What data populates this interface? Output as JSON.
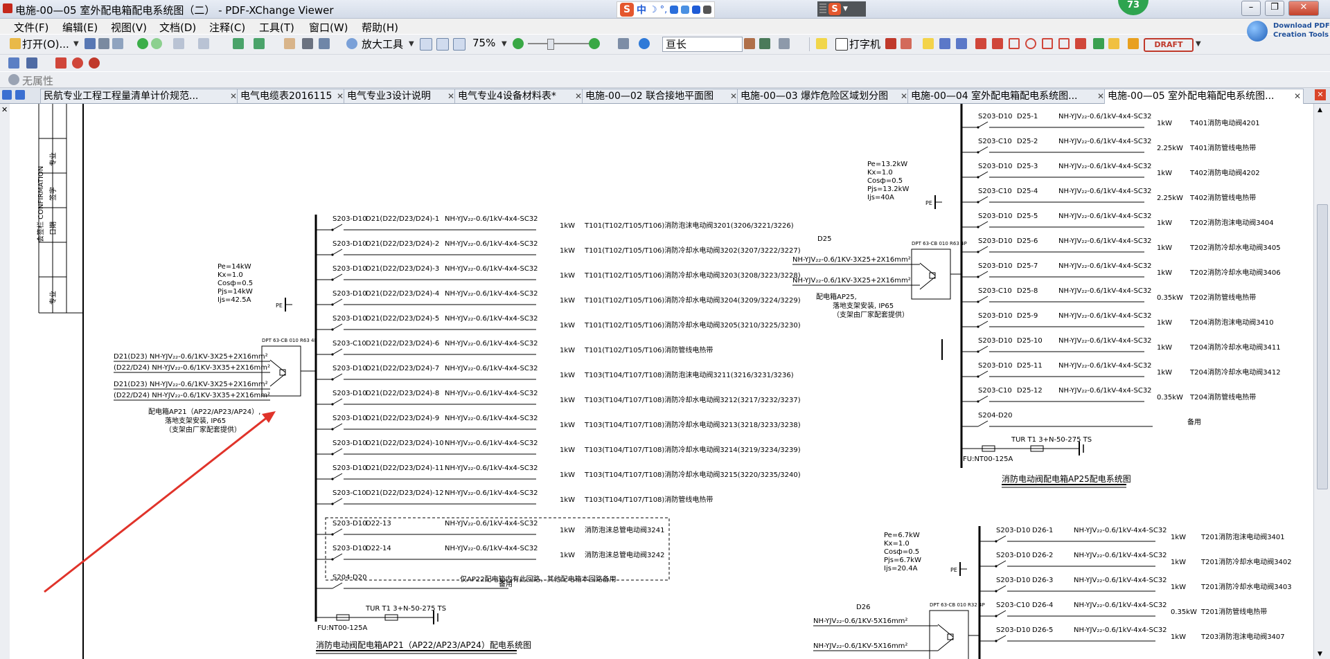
{
  "window": {
    "title": "电施-00—05 室外配电箱配电系统图（二） - PDF-XChange Viewer",
    "badge": "73",
    "ime_cn": "中"
  },
  "menu": [
    "文件(F)",
    "编辑(E)",
    "视图(V)",
    "文档(D)",
    "注释(C)",
    "工具(T)",
    "窗口(W)",
    "帮助(H)"
  ],
  "toolbar": {
    "open_label": "打开(O)...",
    "zoom_tool_label": "放大工具",
    "zoom_value": "75%",
    "search_value": "亘长",
    "typewriter_label": "打字机",
    "draft_stamp": "DRAFT",
    "promo_line1": "Download PDF",
    "promo_line2": "Creation Tools",
    "properties_label": "无属性"
  },
  "tabs": [
    "民航专业工程工程量清单计价规范...",
    "电气电缆表2016115",
    "电气专业3设计说明",
    "电气专业4设备材料表*",
    "电施-00—02 联合接地平面图",
    "电施-00—03 爆炸危险区域划分图",
    "电施-00—04 室外配电箱配电系统图...",
    "电施-00—05 室外配电箱配电系统图..."
  ],
  "drawing": {
    "titleblock": [
      "会签栏 CONFIRMATION",
      "专业",
      "签字",
      "日期"
    ],
    "ap21": {
      "params": [
        "Pe=14kW",
        "Kx=1.0",
        "Cosф=0.5",
        "Pjs=14kW",
        "Ijs=42.5A"
      ],
      "pe_label": "PE",
      "switch_label": "DPT 63-CB 010 R63 4P",
      "feeds": [
        "D21(D23) NH-YJV₂₂-0.6/1KV-3X25+2X16mm²",
        "(D22/D24) NH-YJV₂₂-0.6/1KV-3X35+2X16mm²",
        "D21(D23) NH-YJV₂₂-0.6/1KV-3X25+2X16mm²",
        "(D22/D24) NH-YJV₂₂-0.6/1KV-3X35+2X16mm²"
      ],
      "desc": [
        "配电箱AP21（AP22/AP23/AP24）,",
        "落地支架安装, IP65",
        "（支架由厂家配套提供）"
      ],
      "circuits": [
        {
          "breaker": "S203-D10",
          "id": "D21(D22/D23/D24)-1",
          "cable": "NH-YJV₂₂-0.6/1kV-4x4-SC32",
          "kw": "1kW",
          "load": "T101(T102/T105/T106)消防泡沫电动阀3201(3206/3221/3226)"
        },
        {
          "breaker": "S203-D10",
          "id": "D21(D22/D23/D24)-2",
          "cable": "NH-YJV₂₂-0.6/1kV-4x4-SC32",
          "kw": "1kW",
          "load": "T101(T102/T105/T106)消防冷却水电动阀3202(3207/3222/3227)"
        },
        {
          "breaker": "S203-D10",
          "id": "D21(D22/D23/D24)-3",
          "cable": "NH-YJV₂₂-0.6/1kV-4x4-SC32",
          "kw": "1kW",
          "load": "T101(T102/T105/T106)消防冷却水电动阀3203(3208/3223/3228)"
        },
        {
          "breaker": "S203-D10",
          "id": "D21(D22/D23/D24)-4",
          "cable": "NH-YJV₂₂-0.6/1kV-4x4-SC32",
          "kw": "1kW",
          "load": "T101(T102/T105/T106)消防冷却水电动阀3204(3209/3224/3229)"
        },
        {
          "breaker": "S203-D10",
          "id": "D21(D22/D23/D24)-5",
          "cable": "NH-YJV₂₂-0.6/1kV-4x4-SC32",
          "kw": "1kW",
          "load": "T101(T102/T105/T106)消防冷却水电动阀3205(3210/3225/3230)"
        },
        {
          "breaker": "S203-C10",
          "id": "D21(D22/D23/D24)-6",
          "cable": "NH-YJV₂₂-0.6/1kV-4x4-SC32",
          "kw": "1kW",
          "load": "T101(T102/T105/T106)消防管线电热带"
        },
        {
          "breaker": "S203-D10",
          "id": "D21(D22/D23/D24)-7",
          "cable": "NH-YJV₂₂-0.6/1kV-4x4-SC32",
          "kw": "1kW",
          "load": "T103(T104/T107/T108)消防泡沫电动阀3211(3216/3231/3236)"
        },
        {
          "breaker": "S203-D10",
          "id": "D21(D22/D23/D24)-8",
          "cable": "NH-YJV₂₂-0.6/1kV-4x4-SC32",
          "kw": "1kW",
          "load": "T103(T104/T107/T108)消防冷却水电动阀3212(3217/3232/3237)"
        },
        {
          "breaker": "S203-D10",
          "id": "D21(D22/D23/D24)-9",
          "cable": "NH-YJV₂₂-0.6/1kV-4x4-SC32",
          "kw": "1kW",
          "load": "T103(T104/T107/T108)消防冷却水电动阀3213(3218/3233/3238)"
        },
        {
          "breaker": "S203-D10",
          "id": "D21(D22/D23/D24)-10",
          "cable": "NH-YJV₂₂-0.6/1kV-4x4-SC32",
          "kw": "1kW",
          "load": "T103(T104/T107/T108)消防冷却水电动阀3214(3219/3234/3239)"
        },
        {
          "breaker": "S203-D10",
          "id": "D21(D22/D23/D24)-11",
          "cable": "NH-YJV₂₂-0.6/1kV-4x4-SC32",
          "kw": "1kW",
          "load": "T103(T104/T107/T108)消防冷却水电动阀3215(3220/3235/3240)"
        },
        {
          "breaker": "S203-C10",
          "id": "D21(D22/D23/D24)-12",
          "cable": "NH-YJV₂₂-0.6/1kV-4x4-SC32",
          "kw": "1kW",
          "load": "T103(T104/T107/T108)消防管线电热带"
        },
        {
          "breaker": "S203-D10",
          "id": "D22-13",
          "cable": "NH-YJV₂₂-0.6/1kV-4x4-SC32",
          "kw": "1kW",
          "load": "消防泡沫总管电动阀3241"
        },
        {
          "breaker": "S203-D10",
          "id": "D22-14",
          "cable": "NH-YJV₂₂-0.6/1kV-4x4-SC32",
          "kw": "1kW",
          "load": "消防泡沫总管电动阀3242"
        }
      ],
      "dashed_note": "仅AP22配电箱内有此回路，其他配电箱本回路备用",
      "spare_breaker": "S204-D20",
      "spare_label": "备用",
      "surge": "TUR T1 3+N-50-275 TS",
      "fuse": "FU:NT00-125A",
      "caption": "消防电动阀配电箱AP21（AP22/AP23/AP24）配电系统图"
    },
    "ap25": {
      "params": [
        "Pe=13.2kW",
        "Kx=1.0",
        "Cosф=0.5",
        "Pjs=13.2kW",
        "Ijs=40A"
      ],
      "pe_label": "PE",
      "feed_id": "D25",
      "switch_label": "DPT 63-CB 010 R63 4P",
      "feeds": [
        "NH-YJV₂₂-0.6/1KV-3X25+2X16mm²",
        "NH-YJV₂₂-0.6/1KV-3X25+2X16mm²"
      ],
      "desc": [
        "配电箱AP25,",
        "落地支架安装, IP65",
        "（支架由厂家配套提供）"
      ],
      "circuits": [
        {
          "breaker": "S203-D10",
          "id": "D25-1",
          "cable": "NH-YJV₂₂-0.6/1kV-4x4-SC32",
          "kw": "1kW",
          "load": "T401消防电动阀4201"
        },
        {
          "breaker": "S203-C10",
          "id": "D25-2",
          "cable": "NH-YJV₂₂-0.6/1kV-4x4-SC32",
          "kw": "2.25kW",
          "load": "T401消防管线电热带"
        },
        {
          "breaker": "S203-D10",
          "id": "D25-3",
          "cable": "NH-YJV₂₂-0.6/1kV-4x4-SC32",
          "kw": "1kW",
          "load": "T402消防电动阀4202"
        },
        {
          "breaker": "S203-C10",
          "id": "D25-4",
          "cable": "NH-YJV₂₂-0.6/1kV-4x4-SC32",
          "kw": "2.25kW",
          "load": "T402消防管线电热带"
        },
        {
          "breaker": "S203-D10",
          "id": "D25-5",
          "cable": "NH-YJV₂₂-0.6/1kV-4x4-SC32",
          "kw": "1kW",
          "load": "T202消防泡沫电动阀3404"
        },
        {
          "breaker": "S203-D10",
          "id": "D25-6",
          "cable": "NH-YJV₂₂-0.6/1kV-4x4-SC32",
          "kw": "1kW",
          "load": "T202消防冷却水电动阀3405"
        },
        {
          "breaker": "S203-D10",
          "id": "D25-7",
          "cable": "NH-YJV₂₂-0.6/1kV-4x4-SC32",
          "kw": "1kW",
          "load": "T202消防冷却水电动阀3406"
        },
        {
          "breaker": "S203-C10",
          "id": "D25-8",
          "cable": "NH-YJV₂₂-0.6/1kV-4x4-SC32",
          "kw": "0.35kW",
          "load": "T202消防管线电热带"
        },
        {
          "breaker": "S203-D10",
          "id": "D25-9",
          "cable": "NH-YJV₂₂-0.6/1kV-4x4-SC32",
          "kw": "1kW",
          "load": "T204消防泡沫电动阀3410"
        },
        {
          "breaker": "S203-D10",
          "id": "D25-10",
          "cable": "NH-YJV₂₂-0.6/1kV-4x4-SC32",
          "kw": "1kW",
          "load": "T204消防冷却水电动阀3411"
        },
        {
          "breaker": "S203-D10",
          "id": "D25-11",
          "cable": "NH-YJV₂₂-0.6/1kV-4x4-SC32",
          "kw": "1kW",
          "load": "T204消防冷却水电动阀3412"
        },
        {
          "breaker": "S203-C10",
          "id": "D25-12",
          "cable": "NH-YJV₂₂-0.6/1kV-4x4-SC32",
          "kw": "0.35kW",
          "load": "T204消防管线电热带"
        }
      ],
      "spare_breaker": "S204-D20",
      "spare_label": "备用",
      "surge": "TUR T1 3+N-50-275 TS",
      "fuse": "FU:NT00-125A",
      "caption": "消防电动阀配电箱AP25配电系统图"
    },
    "ap26": {
      "params": [
        "Pe=6.7kW",
        "Kx=1.0",
        "Cosф=0.5",
        "Pjs=6.7kW",
        "Ijs=20.4A"
      ],
      "pe_label": "PE",
      "feed_id": "D26",
      "switch_label": "DPT 63-CB 010 R32 4P",
      "feeds": [
        "NH-YJV₂₂-0.6/1KV-5X16mm²",
        "NH-YJV₂₂-0.6/1KV-5X16mm²"
      ],
      "circuits": [
        {
          "breaker": "S203-D10",
          "id": "D26-1",
          "cable": "NH-YJV₂₂-0.6/1kV-4x4-SC32",
          "kw": "1kW",
          "load": "T201消防泡沫电动阀3401"
        },
        {
          "breaker": "S203-D10",
          "id": "D26-2",
          "cable": "NH-YJV₂₂-0.6/1kV-4x4-SC32",
          "kw": "1kW",
          "load": "T201消防冷却水电动阀3402"
        },
        {
          "breaker": "S203-D10",
          "id": "D26-3",
          "cable": "NH-YJV₂₂-0.6/1kV-4x4-SC32",
          "kw": "1kW",
          "load": "T201消防冷却水电动阀3403"
        },
        {
          "breaker": "S203-C10",
          "id": "D26-4",
          "cable": "NH-YJV₂₂-0.6/1kV-4x4-SC32",
          "kw": "0.35kW",
          "load": "T201消防管线电热带"
        },
        {
          "breaker": "S203-D10",
          "id": "D26-5",
          "cable": "NH-YJV₂₂-0.6/1kV-4x4-SC32",
          "kw": "1kW",
          "load": "T203消防泡沫电动阀3407"
        }
      ]
    }
  }
}
